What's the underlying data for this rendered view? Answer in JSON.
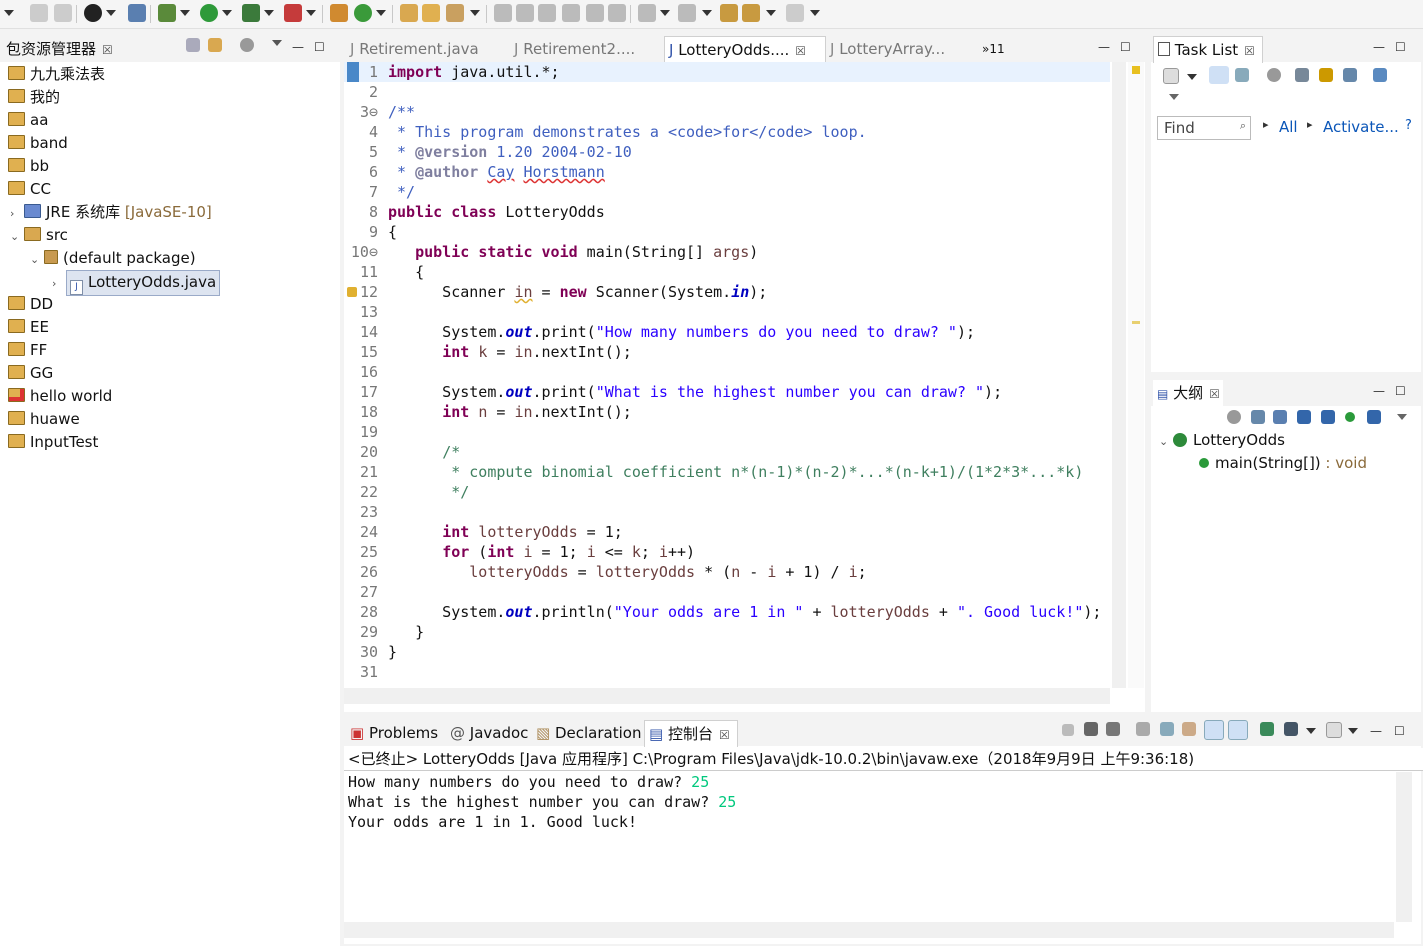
{
  "package_explorer": {
    "title": "包资源管理器",
    "projects": [
      {
        "label": "九九乘法表"
      },
      {
        "label": "我的"
      },
      {
        "label": "aa"
      },
      {
        "label": "band"
      },
      {
        "label": "bb"
      },
      {
        "label": "CC"
      }
    ],
    "jre": {
      "label": "JRE 系统库",
      "suffix": "[JavaSE-10]"
    },
    "src": {
      "label": "src"
    },
    "default_package": {
      "label": "(default package)"
    },
    "file": {
      "label": "LotteryOdds.java"
    },
    "projects_after": [
      {
        "label": "DD"
      },
      {
        "label": "EE"
      },
      {
        "label": "FF"
      },
      {
        "label": "GG"
      },
      {
        "label": "hello world"
      },
      {
        "label": "huawe"
      },
      {
        "label": "InputTest"
      }
    ]
  },
  "editor": {
    "tabs": [
      {
        "label": "Retirement.java"
      },
      {
        "label": "Retirement2...."
      },
      {
        "label": "LotteryOdds...."
      },
      {
        "label": "LotteryArray..."
      }
    ],
    "overflow": "»11",
    "line_numbers": [
      "1",
      "2",
      "3⊖",
      "4",
      "5",
      "6",
      "7",
      "8",
      "9",
      "10⊖",
      "11",
      "12",
      "13",
      "14",
      "15",
      "16",
      "17",
      "18",
      "19",
      "20",
      "21",
      "22",
      "23",
      "24",
      "25",
      "26",
      "27",
      "28",
      "29",
      "30",
      "31"
    ]
  },
  "task_list": {
    "title": "Task List",
    "find_placeholder": "Find",
    "all": "All",
    "activate": "Activate..."
  },
  "outline": {
    "title": "大纲",
    "class": "LotteryOdds",
    "method": "main(String[])",
    "method_type": " : void"
  },
  "bottom": {
    "tabs": [
      {
        "label": "Problems"
      },
      {
        "label": "Javadoc"
      },
      {
        "label": "Declaration"
      },
      {
        "label": "控制台"
      }
    ],
    "status": "<已终止> LotteryOdds [Java 应用程序] C:\\Program Files\\Java\\jdk-10.0.2\\bin\\javaw.exe（2018年9月9日 上午9:36:18)",
    "console": [
      {
        "prompt": "How many numbers do you need to draw? ",
        "input": "25"
      },
      {
        "prompt": "What is the highest number you can draw? ",
        "input": "25"
      },
      {
        "prompt": "Your odds are 1 in 1. Good luck!",
        "input": ""
      }
    ]
  },
  "colors": {
    "keyword": "#7f0055",
    "string": "#2a00ff",
    "comment": "#3f5fbf",
    "field": "#0000c0",
    "console_input": "#00c87d"
  }
}
